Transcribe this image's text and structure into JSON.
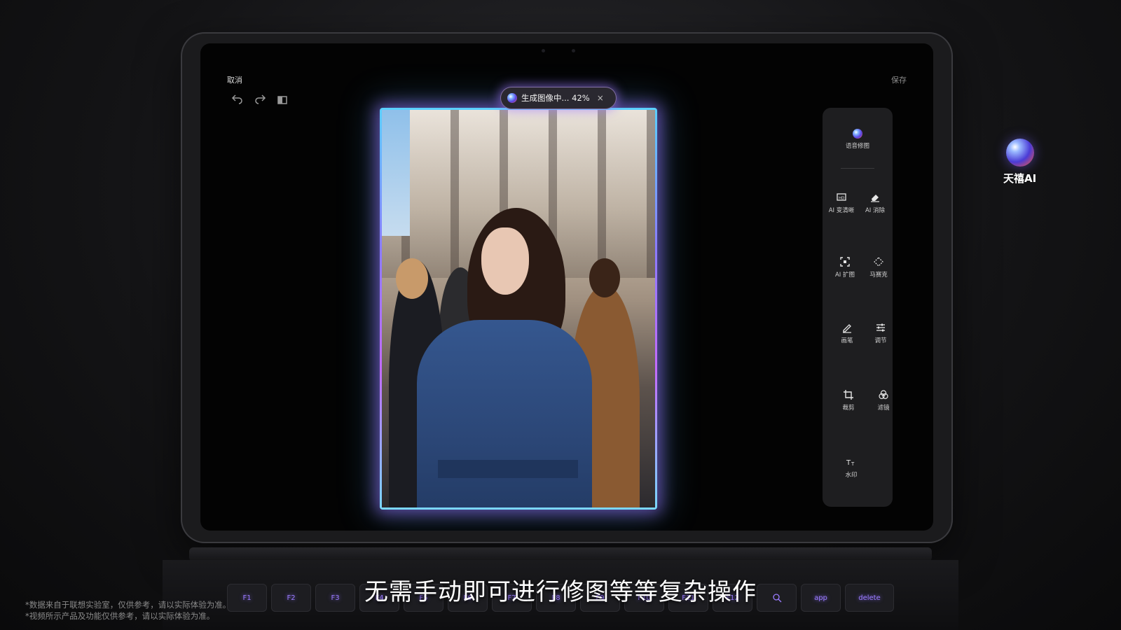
{
  "editor": {
    "cancel_label": "取消",
    "save_label": "保存",
    "progress_text": "生成图像中... 42%",
    "progress_percent": 42,
    "progress_close": "×"
  },
  "tools": [
    {
      "label": "语音修图",
      "icon": "voice-ai-orb-icon"
    },
    {
      "label": "AI 变清晰",
      "icon": "hd-enhance-icon"
    },
    {
      "label": "AI 消除",
      "icon": "eraser-icon"
    },
    {
      "label": "AI 扩图",
      "icon": "expand-icon"
    },
    {
      "label": "马赛克",
      "icon": "mosaic-icon"
    },
    {
      "label": "画笔",
      "icon": "pen-icon"
    },
    {
      "label": "调节",
      "icon": "sliders-icon"
    },
    {
      "label": "裁剪",
      "icon": "crop-icon"
    },
    {
      "label": "滤镜",
      "icon": "filter-icon"
    },
    {
      "label": "水印",
      "icon": "text-watermark-icon"
    }
  ],
  "brand": {
    "label": "天禧AI"
  },
  "keyboard": {
    "keys": [
      "F1",
      "F2",
      "F3",
      "F4",
      "F5",
      "F6",
      "F7",
      "F8",
      "F9",
      "F10",
      "F11",
      "F12",
      "",
      "app",
      "delete"
    ]
  },
  "subtitle": "无需手动即可进行修图等等复杂操作",
  "disclaimers": [
    "*数据来自于联想实验室，仅供参考，请以实际体验为准。",
    "*视频所示产品及功能仅供参考，请以实际体验为准。"
  ],
  "colors": {
    "accent_glow": "#9b7bff",
    "panel_bg": "#1e1e20"
  }
}
